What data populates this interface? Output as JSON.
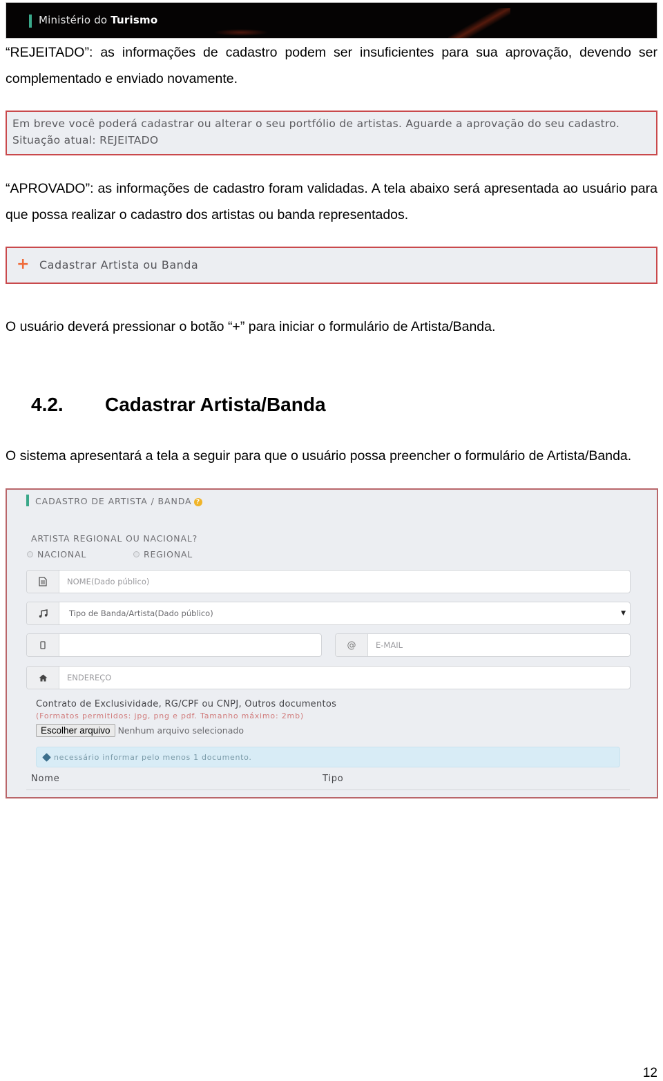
{
  "banner": {
    "title_regular": "Ministério do ",
    "title_bold": "Turismo"
  },
  "paragraphs": {
    "rejeitado": "“REJEITADO”: as informações de cadastro podem ser insuficientes para sua aprovação, devendo ser complementado e enviado novamente.",
    "aprovado": "“APROVADO”: as informações de cadastro foram validadas. A tela abaixo será apresentada ao usuário para que possa realizar o cadastro dos artistas ou banda representados.",
    "botao": "O usuário deverá pressionar o botão “+” para iniciar o formulário de Artista/Banda.",
    "sistema": "O sistema apresentará a tela a seguir para que o usuário possa preencher o formulário de Artista/Banda."
  },
  "status_box": {
    "message": "Em breve você poderá cadastrar ou alterar o seu portfólio de artistas. Aguarde a aprovação do seu cadastro.",
    "status": "Situação atual: REJEITADO"
  },
  "add_box": {
    "icon": "+",
    "label": "Cadastrar Artista ou Banda"
  },
  "section": {
    "number": "4.2.",
    "title": "Cadastrar Artista/Banda"
  },
  "form": {
    "title": "CADASTRO DE ARTISTA / BANDA",
    "help_icon": "?",
    "question": "ARTISTA REGIONAL OU NACIONAL?",
    "radios": [
      {
        "label": "NACIONAL",
        "checked": false
      },
      {
        "label": "REGIONAL",
        "checked": false
      }
    ],
    "fields": {
      "nome": {
        "icon": "document-icon",
        "placeholder": "NOME(Dado público)",
        "value": ""
      },
      "tipo": {
        "icon": "music-icon",
        "selected": "Tipo de Banda/Artista(Dado público)"
      },
      "telefone": {
        "icon": "mobile-icon",
        "placeholder": "",
        "value": ""
      },
      "email": {
        "icon": "at-icon",
        "icon_glyph": "@",
        "placeholder": "E-MAIL",
        "value": ""
      },
      "endereco": {
        "icon": "home-icon",
        "placeholder": "ENDEREÇO",
        "value": ""
      }
    },
    "documents": {
      "title": "Contrato de Exclusividade, RG/CPF ou CNPJ, Outros documentos",
      "hint": "(Formatos permitidos: jpg, png e pdf. Tamanho máximo: 2mb)",
      "button": "Escolher arquivo",
      "file_status": "Nenhum arquivo selecionado"
    },
    "alert": "necessário informar pelo menos 1 documento.",
    "table": {
      "columns": [
        "Nome",
        "Tipo"
      ],
      "rows": []
    }
  },
  "page": {
    "number": "12"
  },
  "colors": {
    "accent_green": "#3aa88a",
    "border_red": "#c9494c",
    "plus_orange": "#ef6b3a",
    "help_yellow": "#f0b429",
    "alert_bg": "#d8ecf6",
    "hint_red": "#d07a7a"
  }
}
